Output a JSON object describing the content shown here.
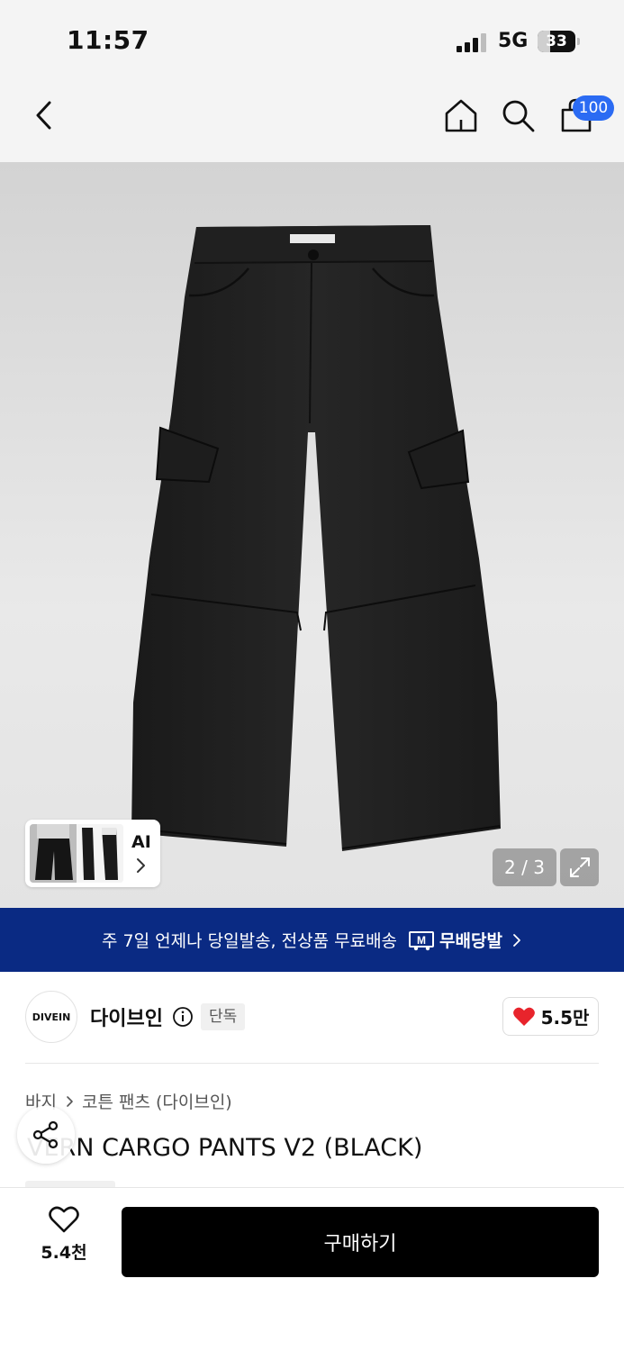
{
  "status_bar": {
    "time": "11:57",
    "network": "5G",
    "battery_percent": 33,
    "battery_label": "33"
  },
  "nav": {
    "back_icon": "chevron-left-icon",
    "home_icon": "home-icon",
    "search_icon": "search-icon",
    "cart_icon": "shopping-bag-icon",
    "cart_badge": "100",
    "badge_color": "#2b6bf3"
  },
  "gallery": {
    "ai_label": "AI",
    "page_counter": "2 / 3",
    "current_page": 2,
    "total_pages": 3,
    "expand_icon": "expand-icon"
  },
  "shipping_banner": {
    "text": "주 7일 언제나 당일발송, 전상품 무료배송",
    "logo_mark": "M",
    "logo_text": "무배당발",
    "background": "#0a2a83"
  },
  "brand": {
    "logo_text": "DIVEIN",
    "name": "다이브인",
    "tag": "단독",
    "like_count": "5.5만",
    "heart_color": "#e8242c"
  },
  "product": {
    "breadcrumb": [
      "바지",
      "코튼 팬츠 (다이브인)"
    ],
    "title": "VERN CARGO PANTS V2 (BLACK)"
  },
  "bottom_bar": {
    "wish_count": "5.4천",
    "buy_label": "구매하기"
  }
}
